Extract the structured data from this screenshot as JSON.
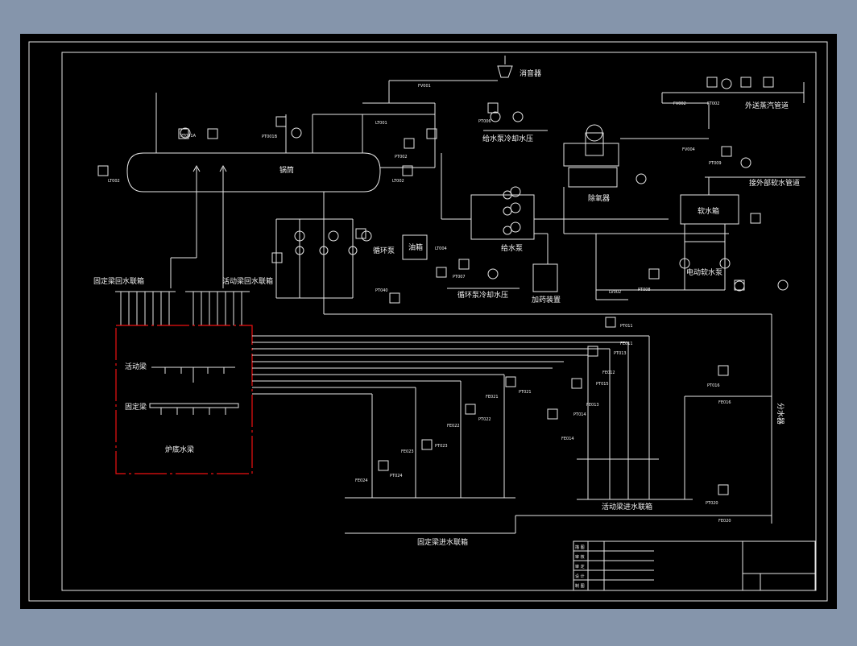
{
  "colors": {
    "paper": "#000000",
    "frame": "#e6e6e6",
    "backdrop": "#8595ab",
    "boiler_outline": "#dd1111"
  },
  "labels": {
    "muffler": "消音器",
    "drum": "锅筒",
    "external_steam": "外送蒸汽管道",
    "feed_pump_cooling": "给水泵冷却水压",
    "deaerator": "除氧器",
    "softened_to_pipe": "接外部软水管道",
    "soft_water_tank": "软水箱",
    "circulating_pump": "循环泵",
    "oil_tank": "油箱",
    "feed_pump": "给水泵",
    "circ_pump_cooling": "循环泵冷却水压",
    "dosing_device": "加药装置",
    "electric_soft_pump": "电动软水泵",
    "fixed_beam_return": "固定梁回水联箱",
    "moving_beam_return": "活动梁回水联箱",
    "moving_beam": "活动梁",
    "fixed_beam": "固定梁",
    "furnace_water_beam": "炉底水梁",
    "water_separator": "分水器",
    "moving_beam_inlet": "活动梁进水联箱",
    "fixed_beam_inlet": "固定梁进水联箱"
  },
  "tags": {
    "fv001": "FV001",
    "ft001": "FT001",
    "fv002": "FV002",
    "ft002": "FT002",
    "fv004": "FV004",
    "ft004": "FT004",
    "lt001": "LT001",
    "lt002": "LT002",
    "pt001a": "PT001A",
    "pt001b": "PT001B",
    "pt002": "PT002",
    "pt003": "PT003",
    "pt006": "PT006",
    "pt009": "PT009",
    "pt008": "PT008",
    "lt004": "LT004",
    "pt007": "PT007",
    "pt040": "PT040",
    "pt041": "PT041",
    "lv002": "LV002",
    "pt011": "PT011",
    "fe011": "FE011",
    "pt013": "PT013",
    "fe012": "FE012",
    "pt015": "PT015",
    "fe013": "FE013",
    "pt014": "PT014",
    "fe014": "FE014",
    "pt021": "PT021",
    "fe021": "FE021",
    "pt022": "PT022",
    "fe022": "FE022",
    "pt023": "PT023",
    "fe023": "FE023",
    "pt024": "PT024",
    "fe024": "FE024",
    "pt016": "PT016",
    "fe016": "FE016",
    "pt020": "PT020",
    "fe020": "FE020"
  },
  "title_block": {
    "rows": [
      "描 图",
      "审 核",
      "审 定",
      "设 计",
      "制 图"
    ]
  }
}
